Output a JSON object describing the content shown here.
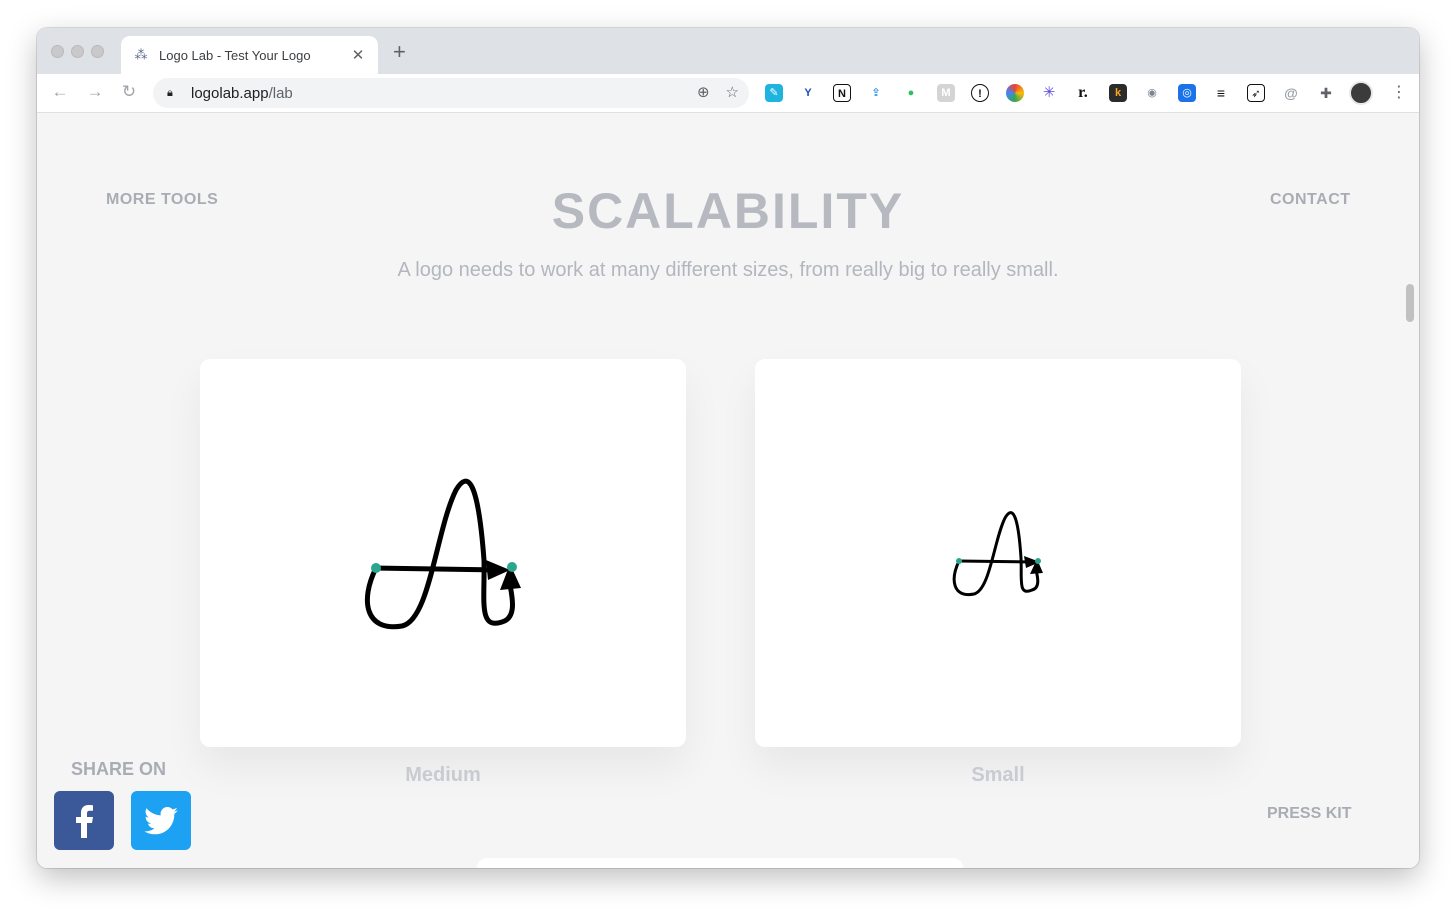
{
  "browser": {
    "tab_title": "Logo Lab - Test Your Logo",
    "close_glyph": "✕",
    "new_tab_glyph": "+",
    "url_host": "logolab.app",
    "url_path": "/lab"
  },
  "nav": {
    "more_tools": "MORE TOOLS",
    "contact": "CONTACT"
  },
  "hero": {
    "title": "SCALABILITY",
    "subtitle": "A logo needs to work at many different sizes, from really big to really small."
  },
  "previews": [
    {
      "label": "Medium"
    },
    {
      "label": "Small"
    }
  ],
  "share": {
    "title": "SHARE ON",
    "facebook_color": "#3b5998",
    "twitter_color": "#1da1f2"
  },
  "footer": {
    "press_kit": "PRESS KIT"
  },
  "colors": {
    "accent_dot": "#2aa58f"
  }
}
